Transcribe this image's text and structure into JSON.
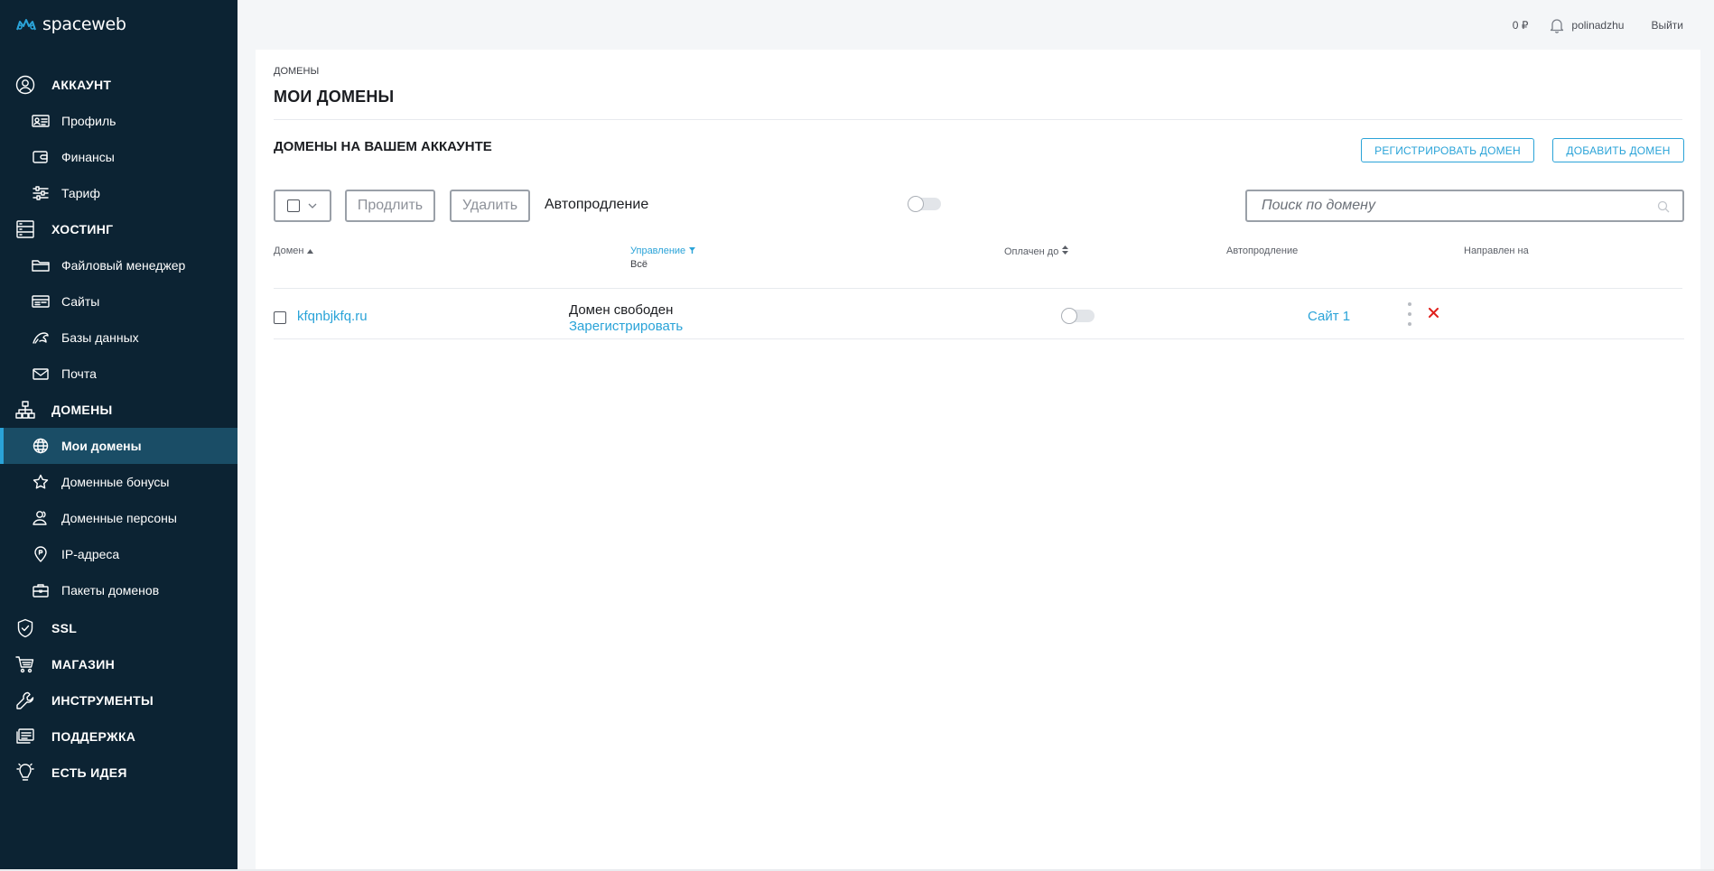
{
  "brand": {
    "name": "spaceweb",
    "accent": "#2aa3d8",
    "sidebar_bg": "#0c2333",
    "active_bg": "#1a4d66"
  },
  "topbar": {
    "balance": "0 ₽",
    "username": "polinadzhu",
    "logout": "Выйти"
  },
  "sidebar": {
    "account": {
      "label": "АККАУНТ",
      "icon": "user-circle-icon",
      "items": [
        {
          "label": "Профиль",
          "icon": "id-card-icon"
        },
        {
          "label": "Финансы",
          "icon": "wallet-icon"
        },
        {
          "label": "Тариф",
          "icon": "sliders-icon"
        }
      ]
    },
    "hosting": {
      "label": "ХОСТИНГ",
      "icon": "server-icon",
      "items": [
        {
          "label": "Файловый менеджер",
          "icon": "folder-icon"
        },
        {
          "label": "Сайты",
          "icon": "sites-icon"
        },
        {
          "label": "Базы данных",
          "icon": "dolphin-icon"
        },
        {
          "label": "Почта",
          "icon": "mail-icon"
        }
      ]
    },
    "domains": {
      "label": "ДОМЕНЫ",
      "icon": "sitemap-icon",
      "items": [
        {
          "label": "Мои домены",
          "icon": "globe-icon",
          "active": true
        },
        {
          "label": "Доменные бонусы",
          "icon": "star-icon"
        },
        {
          "label": "Доменные персоны",
          "icon": "persons-icon"
        },
        {
          "label": "IP-адреса",
          "icon": "location-pin-icon"
        },
        {
          "label": "Пакеты доменов",
          "icon": "briefcase-icon"
        }
      ]
    },
    "ssl": {
      "label": "SSL",
      "icon": "shield-icon"
    },
    "shop": {
      "label": "МАГАЗИН",
      "icon": "cart-icon"
    },
    "tools": {
      "label": "ИНСТРУМЕНТЫ",
      "icon": "wrench-icon"
    },
    "support": {
      "label": "ПОДДЕРЖКА",
      "icon": "support-icon"
    },
    "idea": {
      "label": "ЕСТЬ ИДЕЯ",
      "icon": "lightbulb-icon"
    }
  },
  "main": {
    "breadcrumb": "ДОМЕНЫ",
    "title": "МОИ ДОМЕНЫ",
    "section_title": "ДОМЕНЫ НА ВАШЕМ АККАУНТЕ",
    "register_button": "РЕГИСТРИРОВАТЬ ДОМЕН",
    "add_button": "ДОБАВИТЬ ДОМЕН",
    "toolbar": {
      "extend_button": "Продлить",
      "delete_button": "Удалить",
      "autorenew_label": "Автопродление",
      "autorenew_on": false,
      "search_placeholder": "Поиск по домену",
      "search_value": ""
    },
    "table": {
      "columns": {
        "domain": "Домен",
        "management": "Управление",
        "management_filter": "Всё",
        "paid_until": "Оплачен до",
        "autorenew": "Автопродление",
        "points_to": "Направлен на"
      },
      "rows": [
        {
          "domain": "kfqnbjkfq.ru",
          "status": "Домен свободен",
          "action": "Зарегистрировать",
          "paid_until": "",
          "autorenew_on": false,
          "points_to": "Сайт 1"
        }
      ]
    }
  }
}
